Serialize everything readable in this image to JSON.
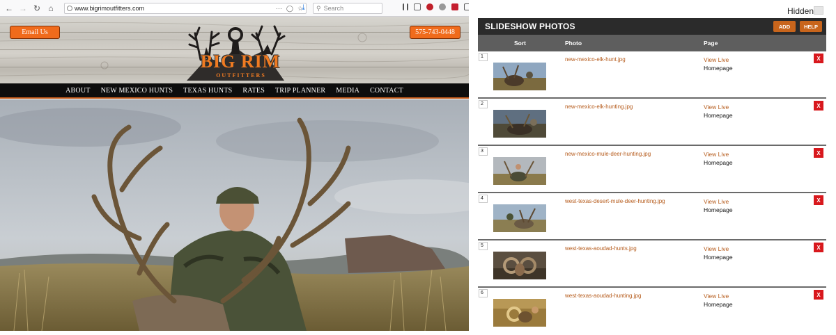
{
  "browser": {
    "url": "www.bigrimoutfitters.com",
    "search_placeholder": "Search"
  },
  "site": {
    "email_button": "Email Us",
    "phone_button": "575-743-0448",
    "logo_title": "BIG RIM",
    "logo_subtitle": "OUTFITTERS",
    "nav": [
      "ABOUT",
      "NEW MEXICO HUNTS",
      "TEXAS HUNTS",
      "RATES",
      "TRIP PLANNER",
      "MEDIA",
      "CONTACT"
    ]
  },
  "admin": {
    "hidden_label": "Hidden:",
    "title": "SLIDESHOW PHOTOS",
    "add_button": "ADD",
    "help_button": "HELP",
    "columns": {
      "sort": "Sort",
      "photo": "Photo",
      "page": "Page"
    },
    "rows": [
      {
        "sort": "1",
        "photo": "new-mexico-elk-hunt.jpg",
        "view": "View Live",
        "page": "Homepage",
        "delete": "X"
      },
      {
        "sort": "2",
        "photo": "new-mexico-elk-hunting.jpg",
        "view": "View Live",
        "page": "Homepage",
        "delete": "X"
      },
      {
        "sort": "3",
        "photo": "new-mexico-mule-deer-hunting.jpg",
        "view": "View Live",
        "page": "Homepage",
        "delete": "X"
      },
      {
        "sort": "4",
        "photo": "west-texas-desert-mule-deer-hunting.jpg",
        "view": "View Live",
        "page": "Homepage",
        "delete": "X"
      },
      {
        "sort": "5",
        "photo": "west-texas-aoudad-hunts.jpg",
        "view": "View Live",
        "page": "Homepage",
        "delete": "X"
      },
      {
        "sort": "6",
        "photo": "west-texas-aoudad-hunting.jpg",
        "view": "View Live",
        "page": "Homepage",
        "delete": "X"
      }
    ]
  },
  "colors": {
    "accent": "#f06b1c",
    "link": "#b55a1a",
    "delete": "#d8181d",
    "panel_header": "#2b2b2b"
  }
}
